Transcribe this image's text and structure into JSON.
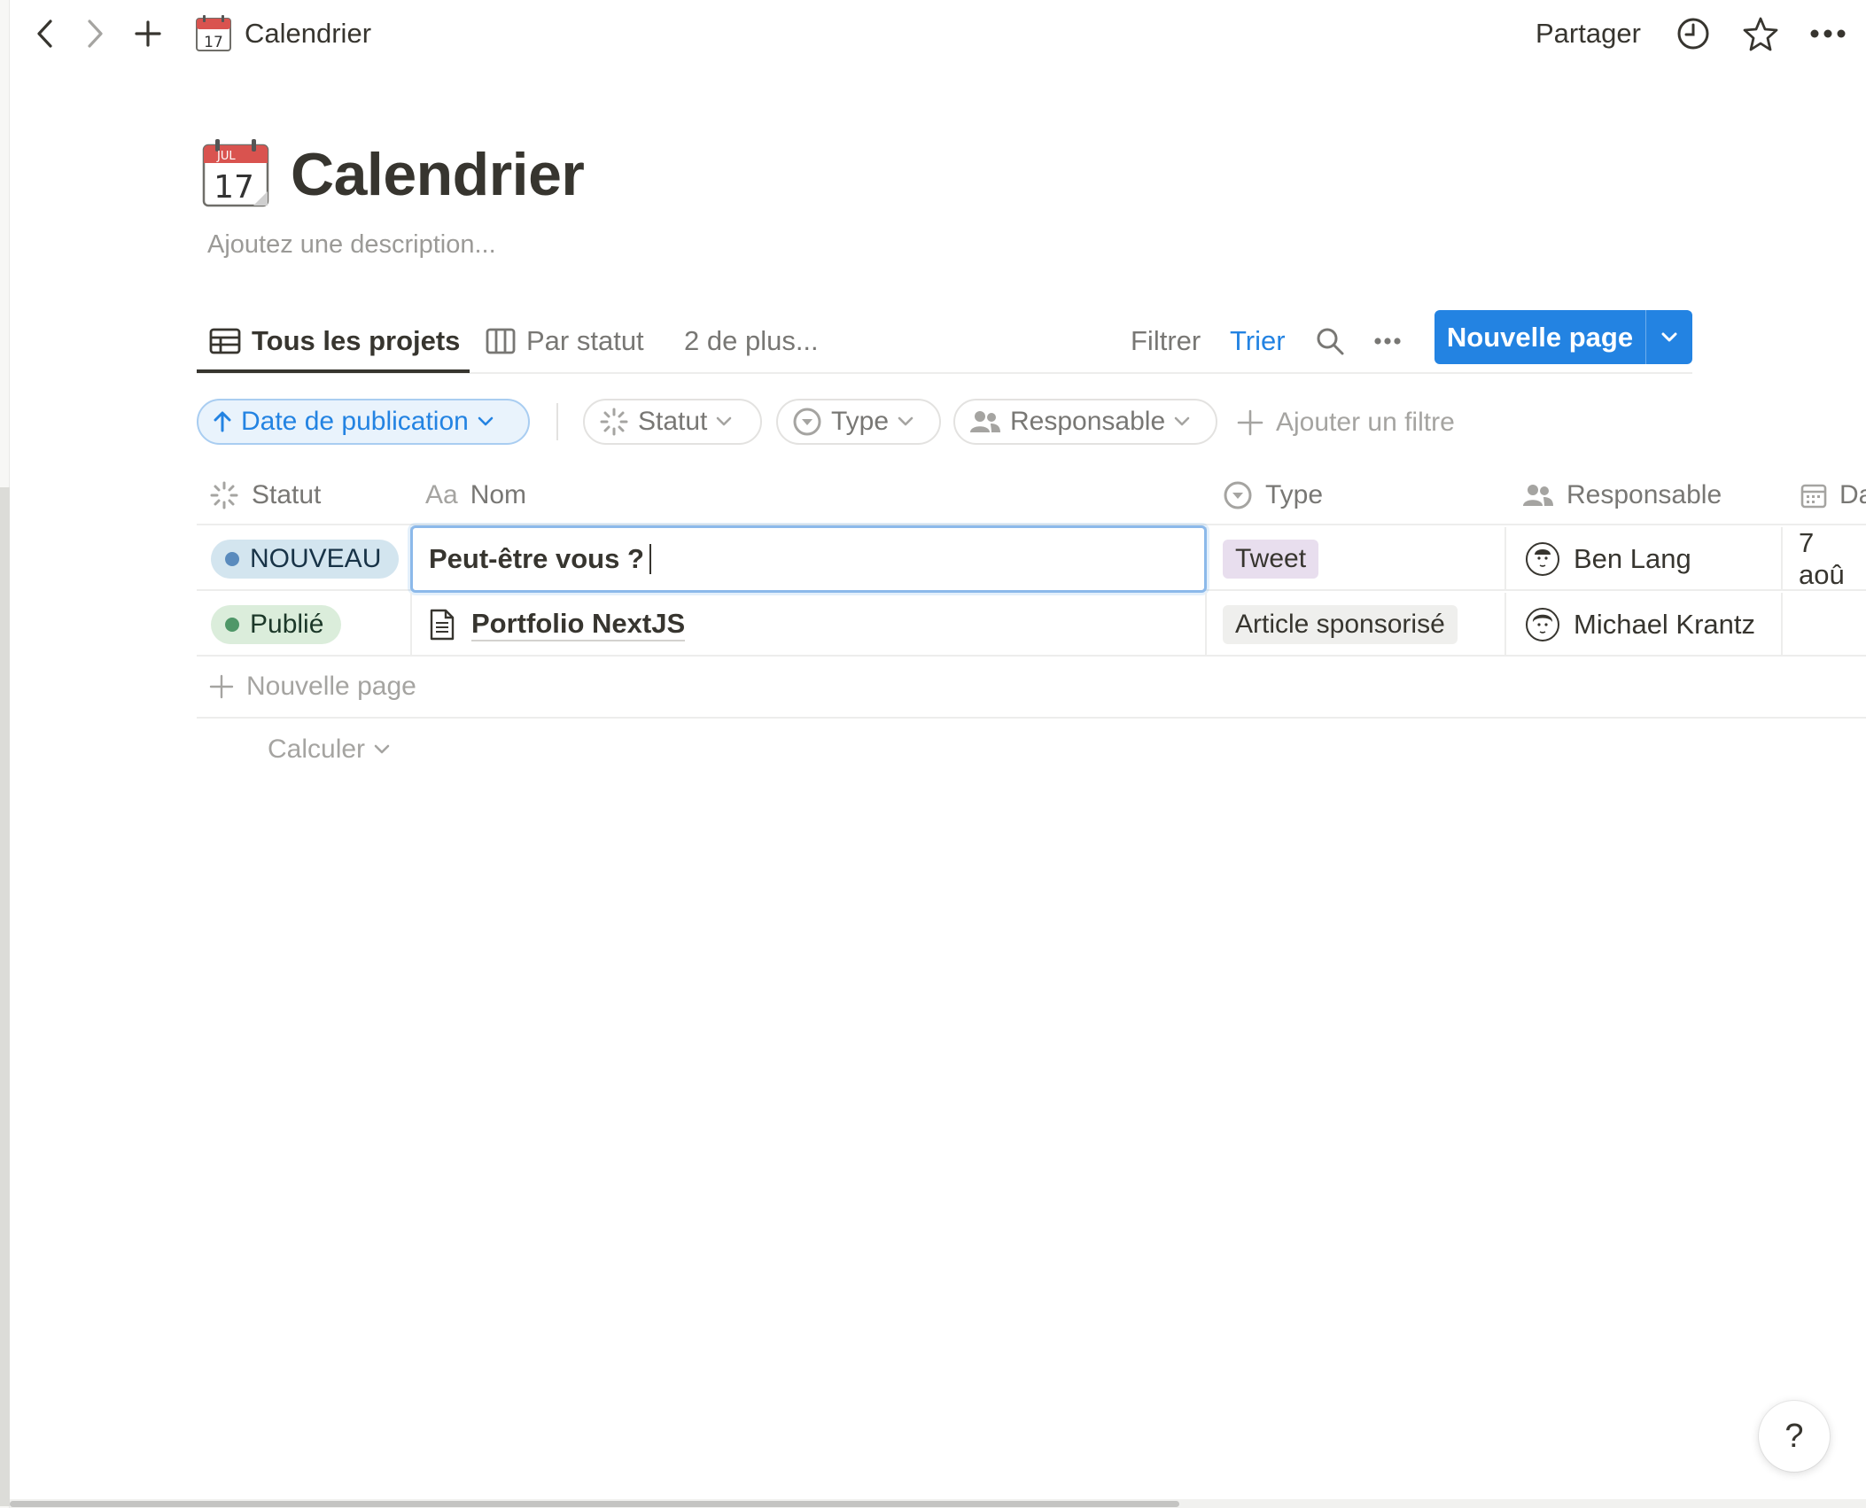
{
  "topbar": {
    "breadcrumb_title": "Calendrier",
    "share_label": "Partager",
    "icons": [
      "back-icon",
      "forward-icon",
      "plus-icon",
      "calendar-icon",
      "history-icon",
      "star-icon",
      "more-icon"
    ]
  },
  "header": {
    "title": "Calendrier",
    "description_placeholder": "Ajoutez une description..."
  },
  "views": {
    "tabs": [
      {
        "label": "Tous les projets",
        "icon": "table-icon",
        "active": true
      },
      {
        "label": "Par statut",
        "icon": "board-icon",
        "active": false
      }
    ],
    "more_label": "2 de plus...",
    "filter_label": "Filtrer",
    "sort_label": "Trier",
    "new_page_label": "Nouvelle page"
  },
  "filters": {
    "sort_chip": "Date de publication",
    "chips": [
      "Statut",
      "Type",
      "Responsable"
    ],
    "add_filter_label": "Ajouter un filtre"
  },
  "table": {
    "columns": [
      {
        "label": "Statut",
        "icon": "status-icon"
      },
      {
        "label": "Nom",
        "icon": "text-aa-icon",
        "icon_text": "Aa"
      },
      {
        "label": "Type",
        "icon": "select-icon"
      },
      {
        "label": "Responsable",
        "icon": "people-icon"
      },
      {
        "label": "Da",
        "icon": "date-icon"
      }
    ],
    "rows": [
      {
        "status": "NOUVEAU",
        "status_color": "#5a8bbd",
        "status_bg": "#d3e5ef",
        "name": "Peut-être vous ?",
        "editing": true,
        "type": "Tweet",
        "type_bg": "#e8deee",
        "owner": "Ben Lang",
        "date": "7 aoû"
      },
      {
        "status": "Publié",
        "status_color": "#4f9768",
        "status_bg": "#dbeddb",
        "name": "Portfolio NextJS",
        "editing": false,
        "type": "Article sponsorisé",
        "type_bg": "#efefed",
        "owner": "Michael Krantz",
        "date": ""
      }
    ],
    "new_row_label": "Nouvelle page",
    "calculate_label": "Calculer"
  },
  "help_label": "?"
}
